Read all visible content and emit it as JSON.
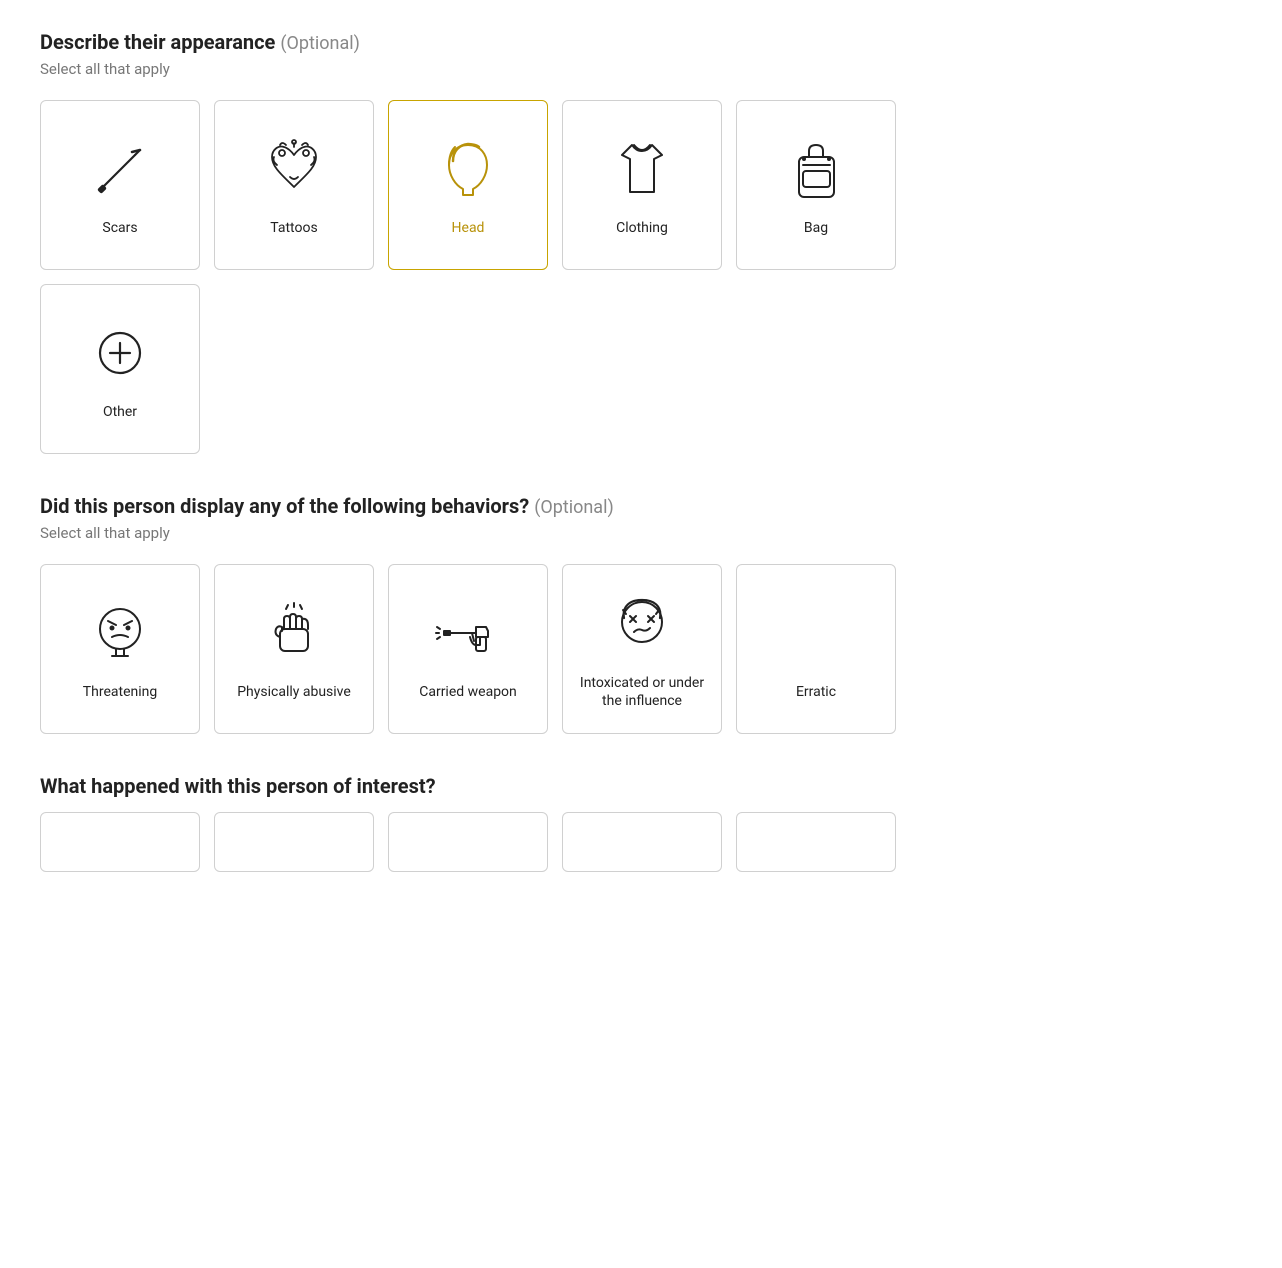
{
  "appearance_section": {
    "title": "Describe their appearance",
    "optional_label": "(Optional)",
    "subtitle": "Select all that apply",
    "cards": [
      {
        "id": "scars",
        "label": "Scars",
        "selected": false
      },
      {
        "id": "tattoos",
        "label": "Tattoos",
        "selected": false
      },
      {
        "id": "head",
        "label": "Head",
        "selected": true
      },
      {
        "id": "clothing",
        "label": "Clothing",
        "selected": false
      },
      {
        "id": "bag",
        "label": "Bag",
        "selected": false
      },
      {
        "id": "other",
        "label": "Other",
        "selected": false
      }
    ]
  },
  "behaviors_section": {
    "title": "Did this person display any of the following behaviors?",
    "optional_label": "(Optional)",
    "subtitle": "Select all that apply",
    "cards": [
      {
        "id": "threatening",
        "label": "Threatening",
        "selected": false
      },
      {
        "id": "physically-abusive",
        "label": "Physically abusive",
        "selected": false
      },
      {
        "id": "carried-weapon",
        "label": "Carried weapon",
        "selected": false
      },
      {
        "id": "intoxicated",
        "label": "Intoxicated or under the influence",
        "selected": false
      },
      {
        "id": "erratic",
        "label": "Erratic",
        "selected": false
      }
    ]
  },
  "happened_section": {
    "title": "What happened with this person of interest?"
  }
}
